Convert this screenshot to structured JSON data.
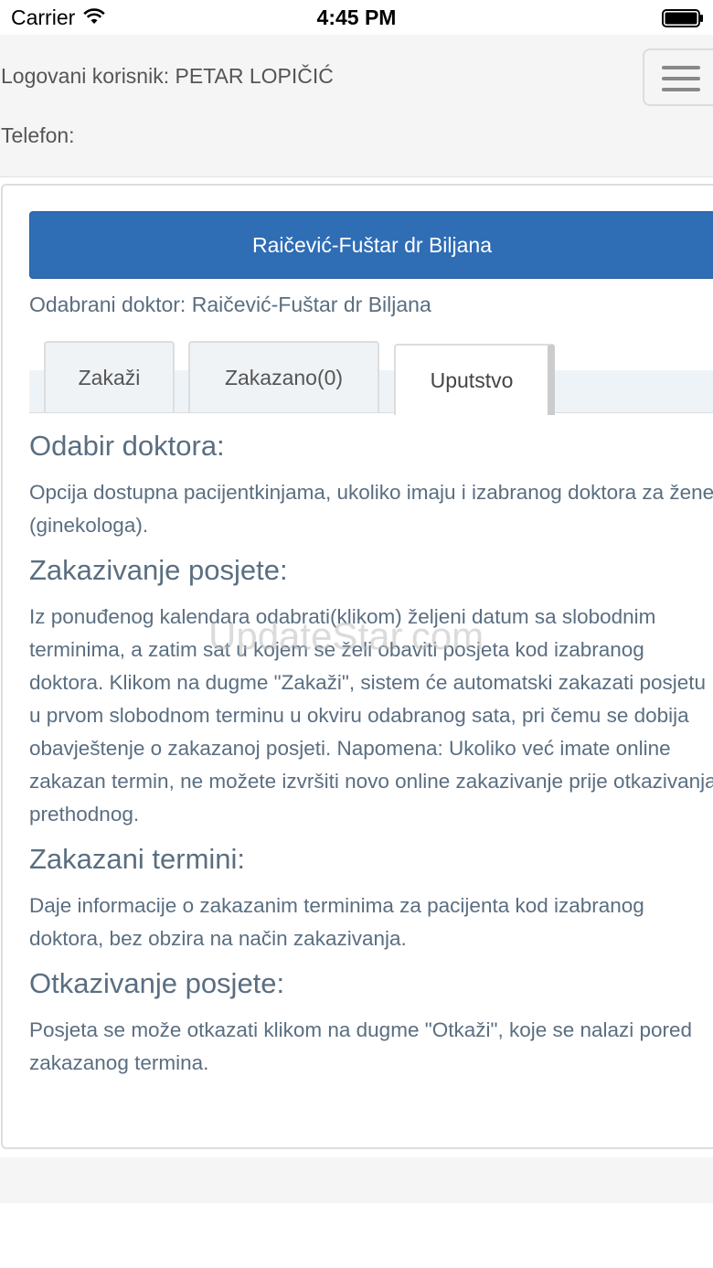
{
  "status_bar": {
    "carrier": "Carrier",
    "time": "4:45 PM"
  },
  "header": {
    "user_label": "Logovani korisnik: PETAR LOPIČIĆ",
    "phone_label": "Telefon:"
  },
  "panel": {
    "doctor_button_label": "Raičević-Fuštar dr Biljana",
    "selected_doctor": "Odabrani doktor: Raičević-Fuštar dr Biljana",
    "tabs": [
      {
        "label": "Zakaži"
      },
      {
        "label": "Zakazano(0)"
      },
      {
        "label": "Uputstvo"
      }
    ],
    "sections": [
      {
        "heading": "Odabir doktora:",
        "text": "Opcija dostupna pacijentkinjama, ukoliko imaju i izabranog doktora za žene (ginekologa)."
      },
      {
        "heading": "Zakazivanje posjete:",
        "text": "Iz ponuđenog kalendara odabrati(klikom) željeni datum sa slobodnim terminima, a zatim sat u kojem se želi obaviti posjeta kod izabranog doktora. Klikom na dugme \"Zakaži\", sistem će automatski zakazati posjetu u prvom slobodnom terminu u okviru odabranog sata, pri čemu se dobija obavještenje o zakazanoj posjeti. Napomena: Ukoliko već imate online zakazan termin, ne možete izvršiti novo online zakazivanje prije otkazivanja prethodnog."
      },
      {
        "heading": "Zakazani termini:",
        "text": "Daje informacije o zakazanim terminima za pacijenta kod izabranog doktora, bez obzira na način zakazivanja."
      },
      {
        "heading": "Otkazivanje posjete:",
        "text": "Posjeta se može otkazati klikom na dugme \"Otkaži\", koje se nalazi pored zakazanog termina."
      }
    ]
  },
  "watermark": "UpdateStar.com",
  "colors": {
    "primary": "#2f6db5",
    "text": "#5a6e80",
    "header_bg": "#f5f5f5"
  }
}
